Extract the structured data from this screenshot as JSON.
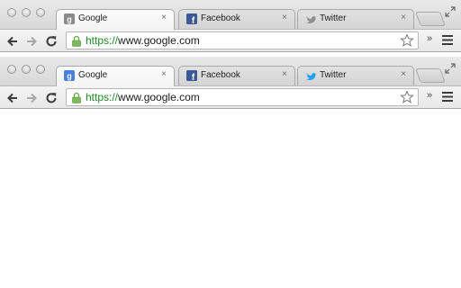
{
  "windows": [
    {
      "variant": "old",
      "tabs": [
        {
          "label": "Google",
          "favicon": "google-favicon-grey",
          "active": true
        },
        {
          "label": "Facebook",
          "favicon": "facebook-favicon",
          "active": false
        },
        {
          "label": "Twitter",
          "favicon": "twitter-favicon-grey",
          "active": false
        }
      ],
      "tab_close": "×",
      "url": {
        "scheme": "https",
        "separator": "://",
        "host": "www.google.com"
      },
      "overflow": "»"
    },
    {
      "variant": "new",
      "tabs": [
        {
          "label": "Google",
          "favicon": "google-favicon-blue",
          "active": true
        },
        {
          "label": "Facebook",
          "favicon": "facebook-favicon",
          "active": false
        },
        {
          "label": "Twitter",
          "favicon": "twitter-favicon-blue",
          "active": false
        }
      ],
      "tab_close": "×",
      "url": {
        "scheme": "https",
        "separator": "://",
        "host": "www.google.com"
      },
      "overflow": "»"
    }
  ],
  "colors": {
    "secure_green": "#1d8a24",
    "facebook_blue": "#3b5998",
    "twitter_blue": "#1da1f2",
    "google_blue": "#4a7fe0"
  }
}
